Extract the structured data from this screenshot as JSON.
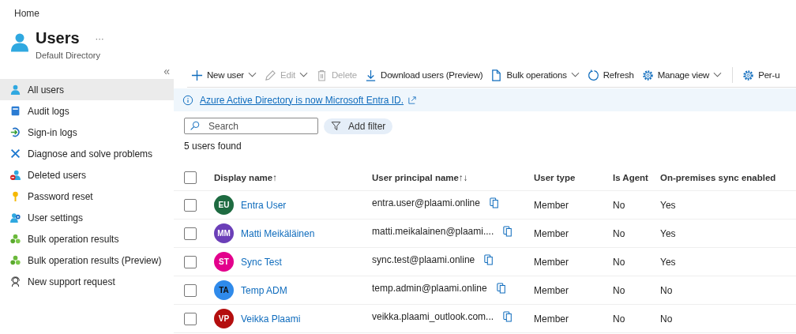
{
  "breadcrumb": "Home",
  "header": {
    "title": "Users",
    "more": "···",
    "subtitle": "Default Directory"
  },
  "sidebar": {
    "collapse": "«",
    "items": [
      {
        "label": "All users",
        "kind": "user",
        "selected": true
      },
      {
        "label": "Audit logs",
        "kind": "book",
        "selected": false
      },
      {
        "label": "Sign-in logs",
        "kind": "signin",
        "selected": false
      },
      {
        "label": "Diagnose and solve problems",
        "kind": "tools",
        "selected": false
      },
      {
        "label": "Deleted users",
        "kind": "deleted",
        "selected": false
      },
      {
        "label": "Password reset",
        "kind": "key",
        "selected": false
      },
      {
        "label": "User settings",
        "kind": "usergear",
        "selected": false
      },
      {
        "label": "Bulk operation results",
        "kind": "bulk",
        "selected": false
      },
      {
        "label": "Bulk operation results (Preview)",
        "kind": "bulk",
        "selected": false
      },
      {
        "label": "New support request",
        "kind": "support",
        "selected": false
      }
    ]
  },
  "toolbar": [
    {
      "label": "New user",
      "kind": "plus",
      "dropdown": true,
      "disabled": false,
      "separator": false
    },
    {
      "label": "Edit",
      "kind": "pencil",
      "dropdown": true,
      "disabled": true,
      "separator": false
    },
    {
      "label": "Delete",
      "kind": "trash",
      "dropdown": false,
      "disabled": true,
      "separator": false
    },
    {
      "label": "Download users (Preview)",
      "kind": "download",
      "dropdown": false,
      "disabled": false,
      "separator": false
    },
    {
      "label": "Bulk operations",
      "kind": "doc",
      "dropdown": true,
      "disabled": false,
      "separator": false
    },
    {
      "label": "Refresh",
      "kind": "refresh",
      "dropdown": false,
      "disabled": false,
      "separator": false
    },
    {
      "label": "Manage view",
      "kind": "gear",
      "dropdown": true,
      "disabled": false,
      "separator": false
    },
    {
      "label": "Per-u",
      "kind": "gear",
      "dropdown": false,
      "disabled": false,
      "separator": true
    }
  ],
  "banner": {
    "text": "Azure Active Directory is now Microsoft Entra ID."
  },
  "search": {
    "placeholder": "Search"
  },
  "filter_button": "Add filter",
  "count": "5 users found",
  "table": {
    "header_checked": false,
    "columns": [
      {
        "label": "Display name",
        "sort": "↑"
      },
      {
        "label": "User principal name",
        "sort": "↑↓"
      },
      {
        "label": "User type"
      },
      {
        "label": "Is Agent"
      },
      {
        "label": "On-premises sync enabled"
      }
    ],
    "rows": [
      {
        "checked": false,
        "initials": "EU",
        "color": "#1e6b41",
        "name": "Entra User",
        "upn": "entra.user@plaami.online",
        "type": "Member",
        "agent": "No",
        "sync": "Yes"
      },
      {
        "checked": false,
        "initials": "MM",
        "color": "#6b3fb8",
        "name": "Matti Meikäläinen",
        "upn": "matti.meikalainen@plaami....",
        "type": "Member",
        "agent": "No",
        "sync": "Yes"
      },
      {
        "checked": false,
        "initials": "ST",
        "color": "#e3008c",
        "name": "Sync Test",
        "upn": "sync.test@plaami.online",
        "type": "Member",
        "agent": "No",
        "sync": "Yes"
      },
      {
        "checked": false,
        "initials": "TA",
        "color": "#2f8aea",
        "name": "Temp ADM",
        "upn": "temp.admin@plaami.online",
        "type": "Member",
        "agent": "No",
        "sync": "No"
      },
      {
        "checked": false,
        "initials": "VP",
        "color": "#b40e0e",
        "name": "Veikka Plaami",
        "upn": "veikka.plaami_outlook.com...",
        "type": "Member",
        "agent": "No",
        "sync": "No"
      }
    ]
  }
}
